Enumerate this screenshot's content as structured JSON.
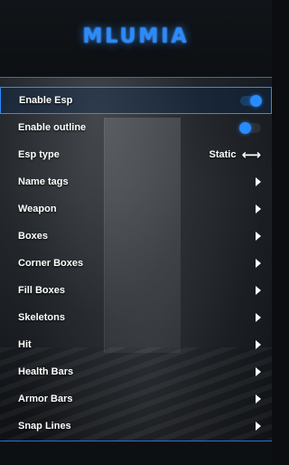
{
  "header": {
    "logo_text": "MLUMIA"
  },
  "menu": {
    "items": [
      {
        "label": "Enable Esp",
        "control": "toggle",
        "state": "on"
      },
      {
        "label": "Enable outline",
        "control": "toggle",
        "state": "off"
      },
      {
        "label": "Esp type",
        "control": "select",
        "value": "Static",
        "icon": "left-right-arrow-icon"
      },
      {
        "label": "Name tags",
        "control": "submenu",
        "icon": "chevron-right-icon"
      },
      {
        "label": "Weapon",
        "control": "submenu",
        "icon": "chevron-right-icon"
      },
      {
        "label": "Boxes",
        "control": "submenu",
        "icon": "chevron-right-icon"
      },
      {
        "label": "Corner Boxes",
        "control": "submenu",
        "icon": "chevron-right-icon"
      },
      {
        "label": "Fill Boxes",
        "control": "submenu",
        "icon": "chevron-right-icon"
      },
      {
        "label": "Skeletons",
        "control": "submenu",
        "icon": "chevron-right-icon"
      },
      {
        "label": "Hit",
        "control": "submenu",
        "icon": "chevron-right-icon"
      },
      {
        "label": "Health Bars",
        "control": "submenu",
        "icon": "chevron-right-icon"
      },
      {
        "label": "Armor Bars",
        "control": "submenu",
        "icon": "chevron-right-icon"
      },
      {
        "label": "Snap Lines",
        "control": "submenu",
        "icon": "chevron-right-icon"
      }
    ]
  },
  "colors": {
    "accent": "#2a8bff",
    "text": "#ffffff",
    "panel": "#0d1013"
  }
}
